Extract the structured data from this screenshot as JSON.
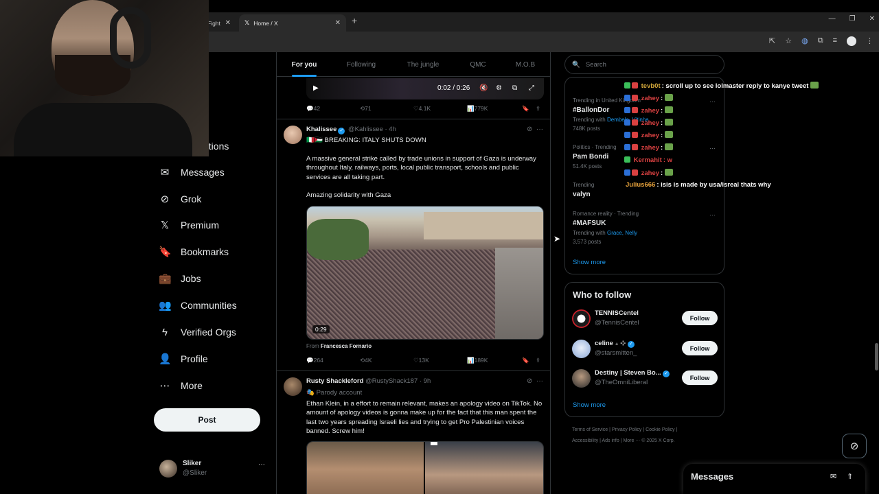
{
  "browser": {
    "tabs": [
      {
        "title": "Fight",
        "active": false
      },
      {
        "title": "Home / X",
        "active": true
      }
    ],
    "favicon_glyph": "𝕏",
    "close_glyph": "✕",
    "new_tab_glyph": "+",
    "window_controls": [
      "—",
      "❐",
      "✕"
    ]
  },
  "nav": {
    "partial_items": [
      "e",
      "ations"
    ],
    "items": [
      {
        "label": "Messages",
        "icon": "mail-icon",
        "glyph": "✉"
      },
      {
        "label": "Grok",
        "icon": "grok-icon",
        "glyph": "⊘"
      },
      {
        "label": "Premium",
        "icon": "x-logo-icon",
        "glyph": "𝕏"
      },
      {
        "label": "Bookmarks",
        "icon": "bookmark-icon",
        "glyph": "🔖"
      },
      {
        "label": "Jobs",
        "icon": "briefcase-icon",
        "glyph": "💼"
      },
      {
        "label": "Communities",
        "icon": "people-icon",
        "glyph": "👥"
      },
      {
        "label": "Verified Orgs",
        "icon": "lightning-icon",
        "glyph": "ϟ"
      },
      {
        "label": "Profile",
        "icon": "person-icon",
        "glyph": "👤"
      },
      {
        "label": "More",
        "icon": "more-circle-icon",
        "glyph": "⋯"
      }
    ],
    "post_label": "Post",
    "account": {
      "name": "Sliker",
      "handle": "@Sliker",
      "more": "···"
    }
  },
  "timeline": {
    "tabs": [
      "For you",
      "Following",
      "The jungle",
      "QMC",
      "M.O.B"
    ],
    "top_video": {
      "time": "0:02 / 0:26"
    },
    "top_actions": {
      "replies": "42",
      "reposts": "71",
      "likes": "4.1K",
      "views": "779K"
    },
    "tweet1": {
      "name": "Khalissee",
      "handle": "@Kahlissee",
      "time": "· 4h",
      "headline": "🇮🇹🇵🇸 BREAKING: ITALY SHUTS DOWN",
      "body": "A massive general strike called by trade unions in support of Gaza is underway throughout Italy, railways, ports, local public transport, schools and public services are all taking part.",
      "body2": "Amazing solidarity with Gaza",
      "video_duration": "0:29",
      "from_prefix": "From",
      "from_name": "Francesca Fornario",
      "actions": {
        "replies": "264",
        "reposts": "4K",
        "likes": "13K",
        "views": "189K"
      }
    },
    "tweet2": {
      "name": "Rusty Shackleford",
      "handle": "@RustyShack187",
      "time": "· 9h",
      "label": "Parody account",
      "body": "Ethan Klein, in a effort to remain relevant, makes an apology video on TikTok. No amount of apology videos is gonna make up for the fact that this man spent the last two years spreading Israeli lies and trying to get Pro Palestinian voices banned. Screw him!"
    }
  },
  "right": {
    "search_placeholder": "Search",
    "trends": [
      {
        "meta": "Trending in United Kingdom",
        "title": "#BallonDor",
        "with_prefix": "Trending with",
        "with_links": "Dembele, Vitinha",
        "posts": "748K posts"
      },
      {
        "meta": "Politics · Trending",
        "title": "Pam Bondi",
        "posts": "51.4K posts"
      },
      {
        "meta": "Trending",
        "title": "valyn"
      },
      {
        "meta": "Romance reality · Trending",
        "title": "#MAFSUK",
        "with_prefix": "Trending with",
        "with_links": "Grace, Nelly",
        "posts": "3,573 posts"
      }
    ],
    "show_more": "Show more",
    "who_to_follow": {
      "title": "Who to follow",
      "accounts": [
        {
          "name": "TENNISCentel",
          "handle": "@TennisCentel"
        },
        {
          "name": "celine ₊ ⊹",
          "handle": "@starsmitten_"
        },
        {
          "name": "Destiny | Steven Bo...",
          "handle": "@TheOmniLiberal"
        }
      ],
      "follow_label": "Follow",
      "show_more": "Show more"
    },
    "footer": {
      "line1": "Terms of Service  |  Privacy Policy  |  Cookie Policy  |",
      "line2": "Accessibility  |  Ads info  |  More ···  © 2025 X Corp."
    }
  },
  "chat": [
    {
      "user": "tevb0t",
      "message": ": scroll up to see lolmaster reply to kanye tweet",
      "color": "#d4a93c"
    },
    {
      "user": "zahey",
      "message": ":",
      "color": "#d94141"
    },
    {
      "user": "zahey",
      "message": ":",
      "color": "#d94141"
    },
    {
      "user": "zahey",
      "message": ":",
      "color": "#d94141"
    },
    {
      "user": "zahey",
      "message": ":",
      "color": "#d94141"
    },
    {
      "user": "zahey",
      "message": ":",
      "color": "#d94141"
    },
    {
      "user": "Kermahit",
      "message": ": w",
      "color": "#d94141"
    },
    {
      "user": "zahey",
      "message": ":",
      "color": "#d94141"
    },
    {
      "user": "Julius666",
      "message": ": isis is made by usa/isreal thats why",
      "color": "#e8a33c"
    }
  ],
  "messages_drawer": {
    "title": "Messages"
  },
  "colors": {
    "accent": "#1d9bf0",
    "background": "#000000",
    "text": "#e7e9ea",
    "muted": "#71767b"
  }
}
